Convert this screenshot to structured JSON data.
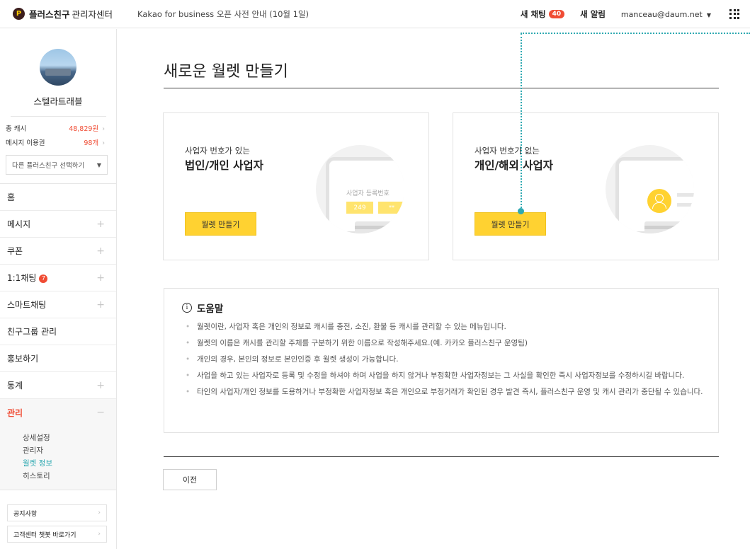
{
  "header": {
    "brand_logo": "P",
    "brand_name": "플러스친구",
    "brand_sub": "관리자센터",
    "notice": "Kakao for business 오픈 사전 안내 (10월 1일)",
    "new_chat_label": "새 채팅",
    "new_chat_count": "40",
    "new_alert_label": "새 알림",
    "account_email": "manceau@daum.net",
    "apps_icon": "grid-icon",
    "badge_color": "#f04c34"
  },
  "sidebar": {
    "profile_name": "스텔라트래블",
    "stats": [
      {
        "label": "총 캐시",
        "value": "48,829원"
      },
      {
        "label": "메시지 이용권",
        "value": "98개"
      }
    ],
    "friend_select": "다른 플러스친구 선택하기",
    "menu": [
      {
        "label": "홈",
        "expandable": false
      },
      {
        "label": "메시지",
        "expandable": true
      },
      {
        "label": "쿠폰",
        "expandable": true
      },
      {
        "label": "1:1채팅",
        "expandable": true,
        "badge": "7"
      },
      {
        "label": "스마트채팅",
        "expandable": true
      },
      {
        "label": "친구그룹 관리",
        "expandable": false
      },
      {
        "label": "홍보하기",
        "expandable": false
      },
      {
        "label": "통계",
        "expandable": true
      },
      {
        "label": "관리",
        "expandable": true,
        "active": true
      }
    ],
    "submenu": [
      "상세설정",
      "관리자",
      "월렛 정보",
      "히스토리"
    ],
    "submenu_current": "월렛 정보",
    "links": [
      "공지사항",
      "고객센터 챗봇 바로가기"
    ],
    "accent_color": "#f04c34",
    "current_color": "#2fa9b1"
  },
  "main": {
    "title": "새로운 월렛 만들기",
    "cards": [
      {
        "sub": "사업자 번호가 있는",
        "main": "법인/개인 사업자",
        "button": "월렛 만들기",
        "art_reg_label": "사업자 등록번호",
        "art_num": "249",
        "art_num2": "**",
        "art_won": "₩"
      },
      {
        "sub": "사업자 번호가 없는",
        "main": "개인/해외 사업자",
        "button": "월렛 만들기",
        "art_won": "₩"
      }
    ],
    "button_color": "#ffd231",
    "help": {
      "icon": "info-icon",
      "title": "도움말",
      "items": [
        "월렛이란, 사업자 혹은 개인의 정보로 캐시를 충전, 소진, 환불 등 캐시를 관리할 수 있는 메뉴입니다.",
        "월렛의 이름은 캐시를 관리할 주체를 구분하기 위한 이름으로 작성해주세요.(예. 카카오 플러스친구 운영팀)",
        "개인의 경우, 본인의 정보로 본인인증 후 월렛 생성이 가능합니다.",
        "사업을 하고 있는 사업자로 등록 및 수정을 하셔야 하며 사업을 하지 않거나 부정확한 사업자정보는 그 사실을 확인한 즉시 사업자정보를 수정하시길 바랍니다.",
        "타인의 사업자/개인 정보를 도용하거나 부정확한 사업자정보 혹은 개인으로 부정거래가 확인된 경우 발견 즉시, 플러스친구 운영 및 캐시 관리가 중단될 수 있습니다."
      ]
    },
    "prev_button": "이전"
  }
}
